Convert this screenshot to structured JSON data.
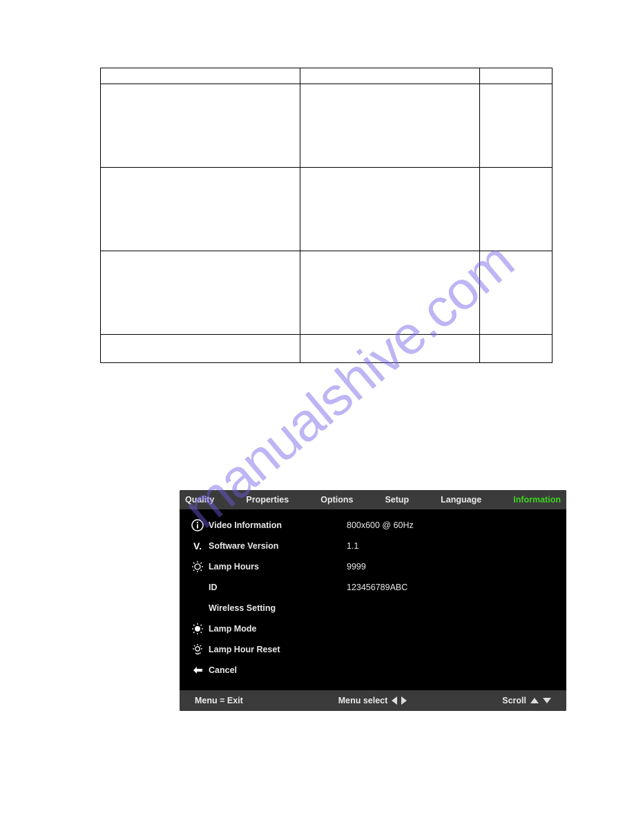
{
  "watermark": "manualshive.com",
  "osd": {
    "tabs": [
      "Quality",
      "Properties",
      "Options",
      "Setup",
      "Language",
      "Information"
    ],
    "active_tab": "Information",
    "rows": [
      {
        "label": "Video Information",
        "value": "800x600 @ 60Hz"
      },
      {
        "label": "Software Version",
        "value": "1.1"
      },
      {
        "label": "Lamp Hours",
        "value": "9999"
      },
      {
        "label": "ID",
        "value": "123456789ABC"
      },
      {
        "label": "Wireless Setting",
        "value": ""
      },
      {
        "label": "Lamp Mode",
        "value": ""
      },
      {
        "label": "Lamp Hour Reset",
        "value": ""
      },
      {
        "label": "Cancel",
        "value": ""
      }
    ],
    "footer": {
      "left": "Menu = Exit",
      "center": "Menu select",
      "right": "Scroll"
    }
  }
}
